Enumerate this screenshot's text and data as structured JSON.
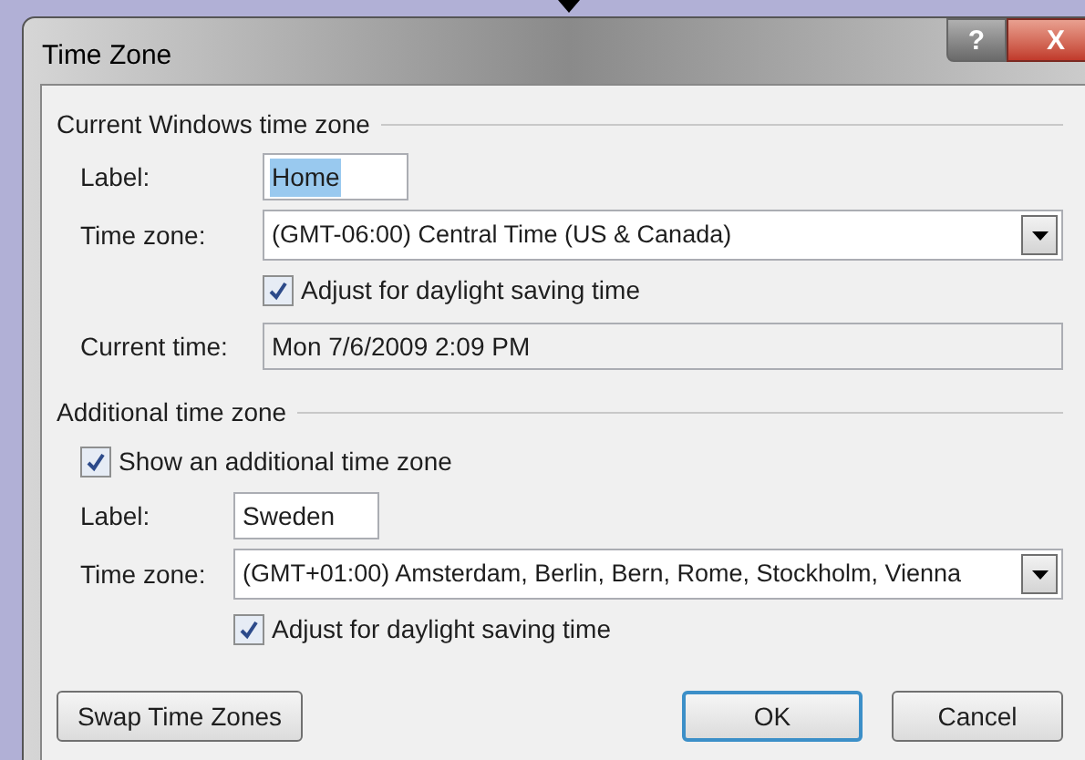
{
  "window": {
    "title": "Time Zone",
    "help_button": "?",
    "close_button": "X"
  },
  "sections": [
    {
      "title": "Current Windows time zone",
      "rows": [
        {
          "kind": "input",
          "label": "Label:",
          "value": "Home",
          "text_selected": true
        },
        {
          "kind": "select",
          "label": "Time zone:",
          "value": "(GMT-06:00) Central Time (US & Canada)"
        },
        {
          "kind": "checkbox",
          "label": "Adjust for daylight saving time",
          "checked": true
        },
        {
          "kind": "readonly",
          "label": "Current time:",
          "value": "Mon 7/6/2009 2:09 PM"
        }
      ]
    },
    {
      "title": "Additional time zone",
      "rows": [
        {
          "kind": "option",
          "label": "Show an additional time zone",
          "checked": true
        },
        {
          "kind": "input",
          "label": "Label:",
          "value": "Sweden",
          "text_selected": false
        },
        {
          "kind": "select",
          "label": "Time zone:",
          "value": "(GMT+01:00) Amsterdam, Berlin, Bern, Rome, Stockholm, Vienna"
        },
        {
          "kind": "checkbox",
          "label": "Adjust for daylight saving time",
          "checked": true
        }
      ]
    }
  ],
  "buttons": [
    {
      "label": "Swap Time Zones",
      "default": false
    },
    {
      "label": "OK",
      "default": true
    },
    {
      "label": "Cancel",
      "default": false
    }
  ]
}
